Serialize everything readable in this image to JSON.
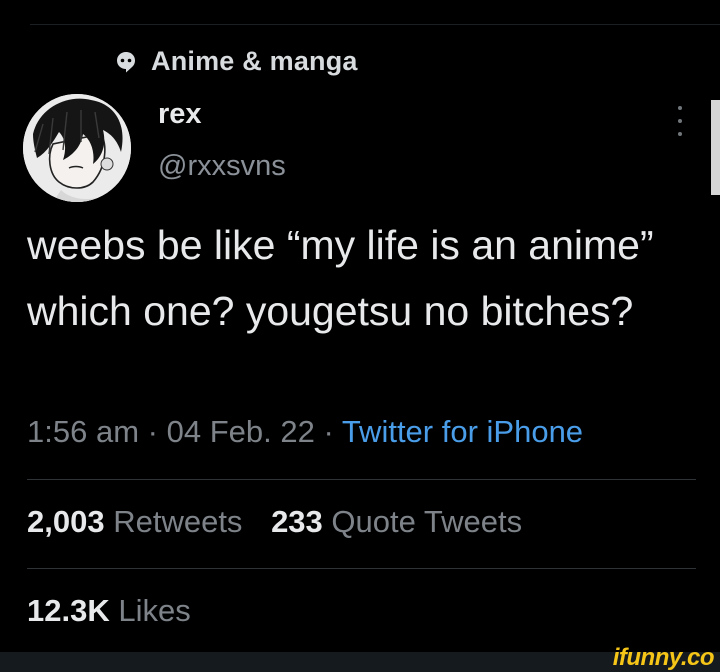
{
  "community": {
    "icon": "community-icon",
    "label": "Anime & manga"
  },
  "author": {
    "display_name": "rex",
    "handle": "@rxxsvns",
    "avatar_icon": "profile-avatar"
  },
  "tweet": {
    "text": "weebs be like “my life is an anime” which one? yougetsu no bitches?",
    "time": "1:56 am",
    "separator": "·",
    "date": "04 Feb. 22",
    "source": "Twitter for iPhone"
  },
  "stats": {
    "retweets_count": "2,003",
    "retweets_label": "Retweets",
    "quotes_count": "233",
    "quotes_label": "Quote Tweets",
    "likes_count": "12.3K",
    "likes_label": "Likes"
  },
  "watermark": "ifunny.co",
  "colors": {
    "background": "#000000",
    "text": "#e7e9ea",
    "muted": "#7d8389",
    "link": "#4a9de9",
    "watermark": "#f5c518"
  }
}
